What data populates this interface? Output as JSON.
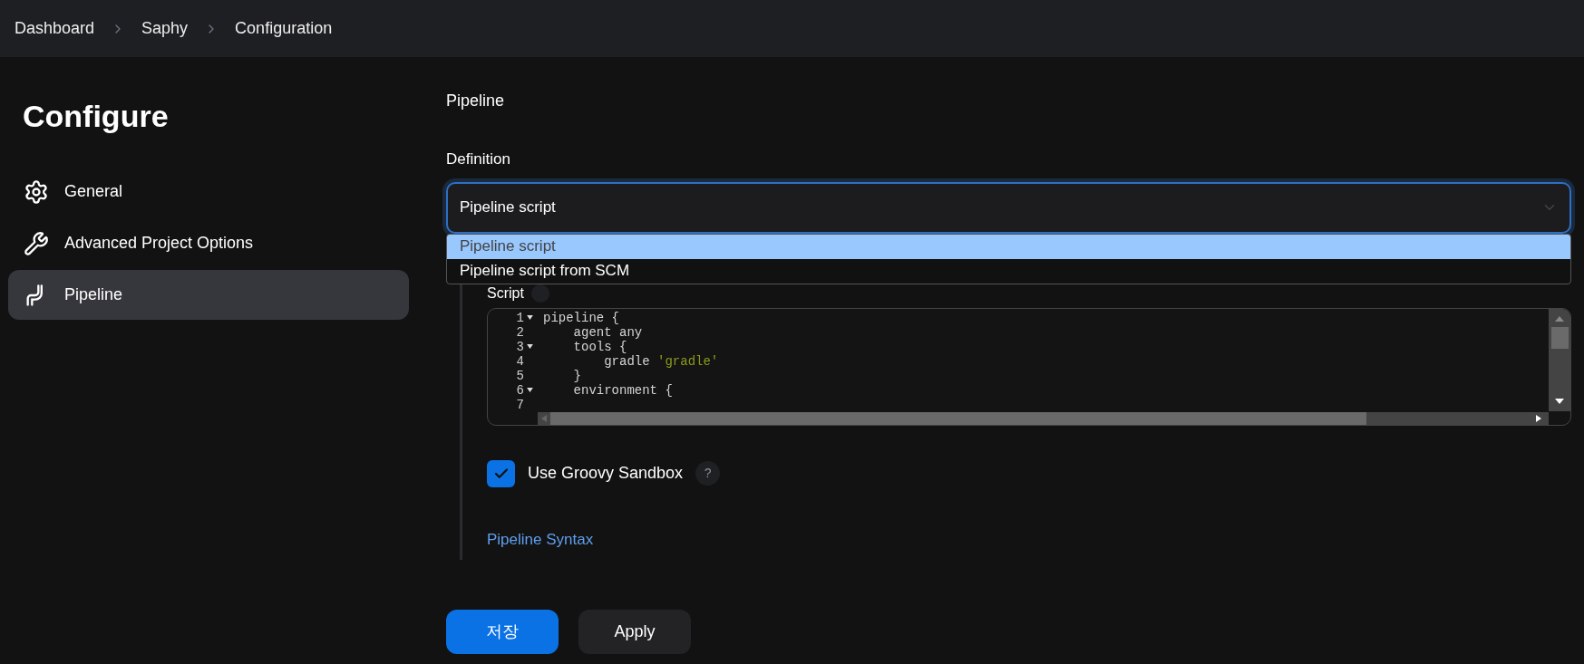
{
  "breadcrumb": [
    "Dashboard",
    "Saphy",
    "Configuration"
  ],
  "sidebar": {
    "title": "Configure",
    "items": [
      {
        "label": "General",
        "selected": false
      },
      {
        "label": "Advanced Project Options",
        "selected": false
      },
      {
        "label": "Pipeline",
        "selected": true
      }
    ]
  },
  "section": {
    "title": "Pipeline",
    "definition": {
      "label": "Definition",
      "value": "Pipeline script",
      "expanded": true,
      "options": [
        {
          "label": "Pipeline script",
          "selected": true
        },
        {
          "label": "Pipeline script from SCM",
          "selected": false
        }
      ]
    },
    "script": {
      "label": "Script",
      "lines": [
        {
          "number": "1",
          "foldable": true,
          "tokens": [
            {
              "text": "pipeline {",
              "kind": "plain"
            }
          ]
        },
        {
          "number": "2",
          "foldable": false,
          "tokens": [
            {
              "text": "    agent any",
              "kind": "plain"
            }
          ]
        },
        {
          "number": "3",
          "foldable": true,
          "tokens": [
            {
              "text": "    tools {",
              "kind": "plain"
            }
          ]
        },
        {
          "number": "4",
          "foldable": false,
          "tokens": [
            {
              "text": "        gradle ",
              "kind": "plain"
            },
            {
              "text": "'gradle'",
              "kind": "string"
            }
          ]
        },
        {
          "number": "5",
          "foldable": false,
          "tokens": [
            {
              "text": "    }",
              "kind": "plain"
            }
          ]
        },
        {
          "number": "6",
          "foldable": true,
          "tokens": [
            {
              "text": "    environment {",
              "kind": "plain"
            }
          ]
        },
        {
          "number": "7",
          "foldable": false
        }
      ]
    },
    "sandbox": {
      "label": "Use Groovy Sandbox",
      "checked": true,
      "help": "?"
    },
    "syntax_link": "Pipeline Syntax"
  },
  "buttons": [
    {
      "label": "저장",
      "kind": "primary"
    },
    {
      "label": "Apply",
      "kind": "secondary"
    }
  ]
}
